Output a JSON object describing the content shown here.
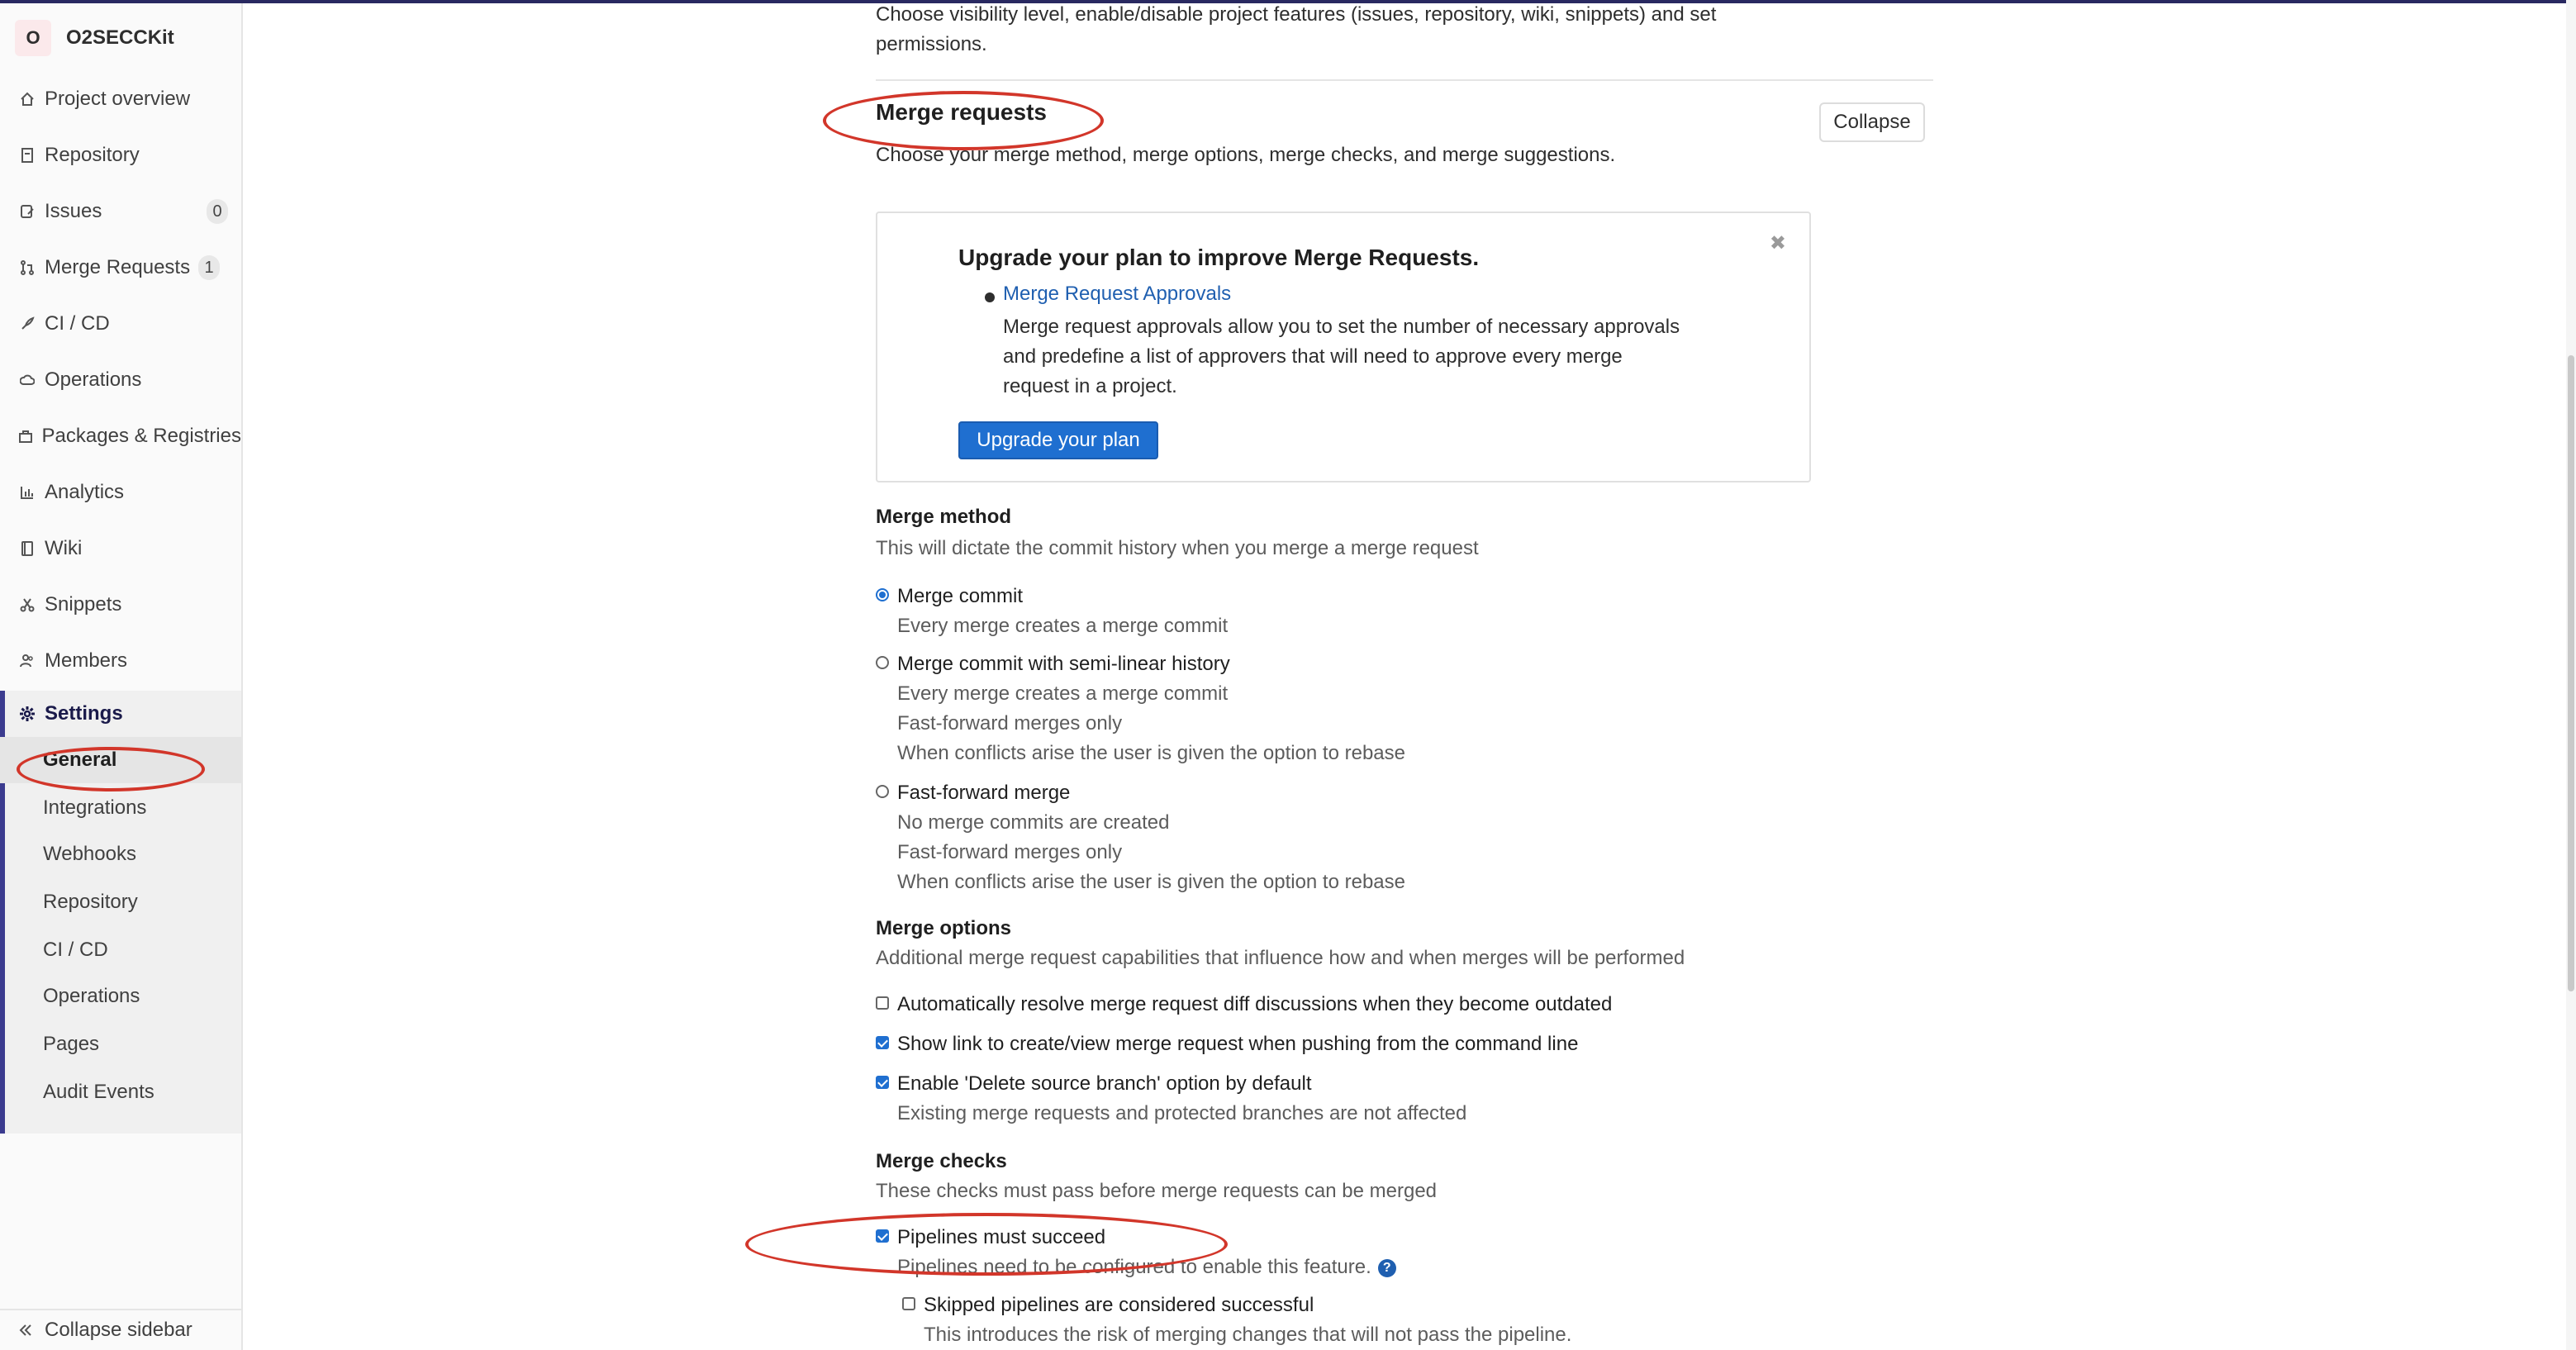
{
  "sidebar": {
    "project_initial": "O",
    "project_name": "O2SECCKit",
    "items": [
      {
        "label": "Project overview",
        "icon": "home-icon"
      },
      {
        "label": "Repository",
        "icon": "document-icon"
      },
      {
        "label": "Issues",
        "icon": "issues-icon",
        "badge": "0"
      },
      {
        "label": "Merge Requests",
        "icon": "merge-request-icon",
        "badge": "1"
      },
      {
        "label": "CI / CD",
        "icon": "rocket-icon"
      },
      {
        "label": "Operations",
        "icon": "cloud-icon"
      },
      {
        "label": "Packages & Registries",
        "icon": "package-icon"
      },
      {
        "label": "Analytics",
        "icon": "chart-icon"
      },
      {
        "label": "Wiki",
        "icon": "book-icon"
      },
      {
        "label": "Snippets",
        "icon": "scissors-icon"
      },
      {
        "label": "Members",
        "icon": "users-icon"
      },
      {
        "label": "Settings",
        "icon": "gear-icon"
      }
    ],
    "settings_subitems": [
      "General",
      "Integrations",
      "Webhooks",
      "Repository",
      "CI / CD",
      "Operations",
      "Pages",
      "Audit Events"
    ],
    "collapse_label": "Collapse sidebar"
  },
  "main": {
    "visibility_desc_line1": "Choose visibility level, enable/disable project features (issues, repository, wiki, snippets) and set",
    "visibility_desc_line2": "permissions.",
    "section_title": "Merge requests",
    "section_desc": "Choose your merge method, merge options, merge checks, and merge suggestions.",
    "collapse_button": "Collapse",
    "upgrade": {
      "title": "Upgrade your plan to improve Merge Requests.",
      "link": "Merge Request Approvals",
      "desc_line1": "Merge request approvals allow you to set the number of necessary approvals",
      "desc_line2": "and predefine a list of approvers that will need to approve every merge",
      "desc_line3": "request in a project.",
      "button": "Upgrade your plan"
    },
    "merge_method": {
      "heading": "Merge method",
      "desc": "This will dictate the commit history when you merge a merge request",
      "options": [
        {
          "label": "Merge commit",
          "selected": true,
          "help": [
            "Every merge creates a merge commit"
          ]
        },
        {
          "label": "Merge commit with semi-linear history",
          "selected": false,
          "help": [
            "Every merge creates a merge commit",
            "Fast-forward merges only",
            "When conflicts arise the user is given the option to rebase"
          ]
        },
        {
          "label": "Fast-forward merge",
          "selected": false,
          "help": [
            "No merge commits are created",
            "Fast-forward merges only",
            "When conflicts arise the user is given the option to rebase"
          ]
        }
      ]
    },
    "merge_options": {
      "heading": "Merge options",
      "desc": "Additional merge request capabilities that influence how and when merges will be performed",
      "options": [
        {
          "label": "Automatically resolve merge request diff discussions when they become outdated",
          "checked": false
        },
        {
          "label": "Show link to create/view merge request when pushing from the command line",
          "checked": true
        },
        {
          "label": "Enable 'Delete source branch' option by default",
          "checked": true,
          "help": "Existing merge requests and protected branches are not affected"
        }
      ]
    },
    "merge_checks": {
      "heading": "Merge checks",
      "desc": "These checks must pass before merge requests can be merged",
      "pipelines_label": "Pipelines must succeed",
      "pipelines_checked": true,
      "pipelines_help": "Pipelines need to be configured to enable this feature.",
      "skipped_label": "Skipped pipelines are considered successful",
      "skipped_checked": false,
      "skipped_help": "This introduces the risk of merging changes that will not pass the pipeline."
    }
  },
  "colors": {
    "accent": "#1f6fd0",
    "annotation": "#d2362a",
    "sidebar_active": "#3b3b8f"
  }
}
